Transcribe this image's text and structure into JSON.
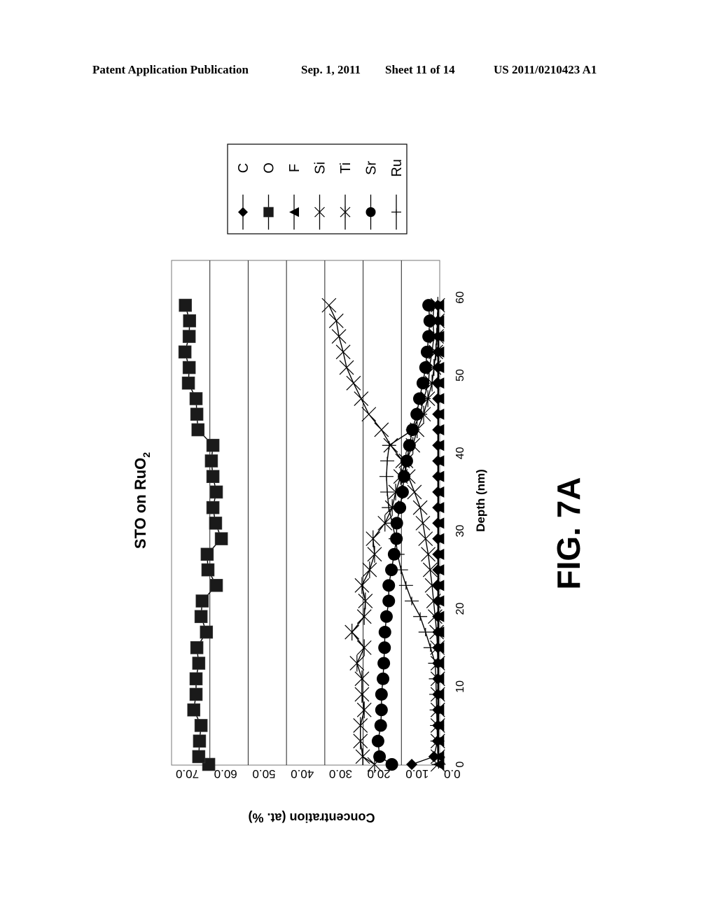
{
  "header": {
    "publication": "Patent Application Publication",
    "date": "Sep. 1, 2011",
    "sheet": "Sheet 11 of 14",
    "number": "US 2011/0210423 A1"
  },
  "figure_label": "FIG. 7A",
  "chart_data": {
    "type": "line",
    "orientation": "rotated 90 degrees clockwise on page",
    "title": "STO on RuO2",
    "title_display": {
      "main": "STO on RuO",
      "subscript": "2"
    },
    "xlabel": "Depth (nm)",
    "ylabel": "Concentration (at. %)",
    "xlim": [
      0,
      60
    ],
    "ylim": [
      0,
      70
    ],
    "xticks": [
      "0",
      "10",
      "20",
      "30",
      "40",
      "50",
      "60"
    ],
    "yticks": [
      "0.0",
      "10.0",
      "20.0",
      "30.0",
      "40.0",
      "50.0",
      "60.0",
      "70.0"
    ],
    "grid": "horizontal gridlines at each y tick",
    "legend_position": "right (top of page when rotated)",
    "x": [
      0,
      1,
      3,
      5,
      7,
      9,
      11,
      13,
      15,
      17,
      19,
      21,
      23,
      25,
      27,
      29,
      31,
      33,
      35,
      37,
      39,
      41,
      43,
      45,
      47,
      49,
      51,
      53,
      55,
      57,
      59
    ],
    "series": [
      {
        "name": "C",
        "marker": "diamond",
        "values": [
          7.3,
          1.5,
          0.6,
          0.5,
          0.5,
          0.5,
          0.5,
          0.5,
          0.5,
          0.5,
          0.5,
          0.5,
          0.5,
          0.5,
          0.5,
          0.5,
          0.5,
          0.5,
          0.5,
          0.5,
          0.5,
          0.5,
          0.5,
          0.5,
          0.5,
          0.5,
          0.5,
          0.5,
          0.5,
          0.5,
          0.5
        ]
      },
      {
        "name": "O",
        "marker": "square",
        "values": [
          60.3,
          62.9,
          62.7,
          62.3,
          64.2,
          63.6,
          63.6,
          62.9,
          63.4,
          60.9,
          62.3,
          62.0,
          58.3,
          60.5,
          60.7,
          57.0,
          58.5,
          59.2,
          58.3,
          59.2,
          59.6,
          59.2,
          63.1,
          63.4,
          63.6,
          65.6,
          65.4,
          66.5,
          65.4,
          65.3,
          66.4
        ]
      },
      {
        "name": "F",
        "marker": "triangle",
        "values": [
          0.3,
          0.3,
          0.3,
          0.3,
          0.3,
          0.3,
          0.3,
          0.3,
          0.3,
          0.3,
          0.3,
          0.3,
          0.3,
          0.3,
          0.3,
          0.3,
          0.3,
          0.3,
          0.3,
          0.3,
          0.3,
          0.3,
          0.3,
          0.3,
          0.3,
          0.3,
          0.3,
          0.3,
          0.3,
          0.3,
          0.3
        ]
      },
      {
        "name": "Si",
        "marker": "x",
        "values": [
          0.5,
          0.5,
          0.5,
          0.5,
          0.5,
          0.5,
          0.5,
          0.5,
          0.6,
          0.8,
          1.2,
          1.6,
          2.0,
          2.5,
          3.0,
          3.7,
          4.4,
          5.1,
          6.6,
          8.2,
          9.7,
          12.8,
          15.2,
          18.5,
          20.5,
          22.5,
          24.3,
          25.2,
          26.3,
          27.0,
          28.9
        ]
      },
      {
        "name": "Ti",
        "marker": "asterisk",
        "values": [
          17.0,
          20.1,
          20.7,
          20.7,
          19.7,
          20.3,
          20.3,
          21.6,
          19.7,
          22.9,
          19.7,
          19.4,
          20.3,
          18.3,
          17.0,
          17.4,
          14.3,
          12.4,
          11.5,
          10.2,
          8.8,
          7.0,
          5.9,
          4.2,
          3.1,
          2.0,
          1.5,
          1.0,
          0.8,
          0.6,
          0.5
        ]
      },
      {
        "name": "Sr",
        "marker": "circle",
        "values": [
          12.5,
          15.7,
          16.1,
          15.4,
          15.2,
          15.2,
          14.8,
          14.6,
          14.4,
          14.3,
          13.9,
          13.3,
          13.3,
          12.6,
          11.9,
          11.3,
          11.2,
          10.4,
          9.7,
          9.3,
          8.6,
          7.9,
          7.1,
          6.0,
          5.3,
          4.4,
          3.7,
          3.3,
          2.9,
          2.6,
          2.9
        ]
      },
      {
        "name": "Ru",
        "marker": "plus",
        "values": [
          0.3,
          0.5,
          0.6,
          0.7,
          0.8,
          0.9,
          1.0,
          1.2,
          2.4,
          3.7,
          5.1,
          7.3,
          8.8,
          10.1,
          11.0,
          11.5,
          12.4,
          13.3,
          13.7,
          13.9,
          13.7,
          13.2,
          7.0,
          5.1,
          4.2,
          2.9,
          2.7,
          2.0,
          1.5,
          1.8,
          1.5
        ]
      }
    ]
  }
}
